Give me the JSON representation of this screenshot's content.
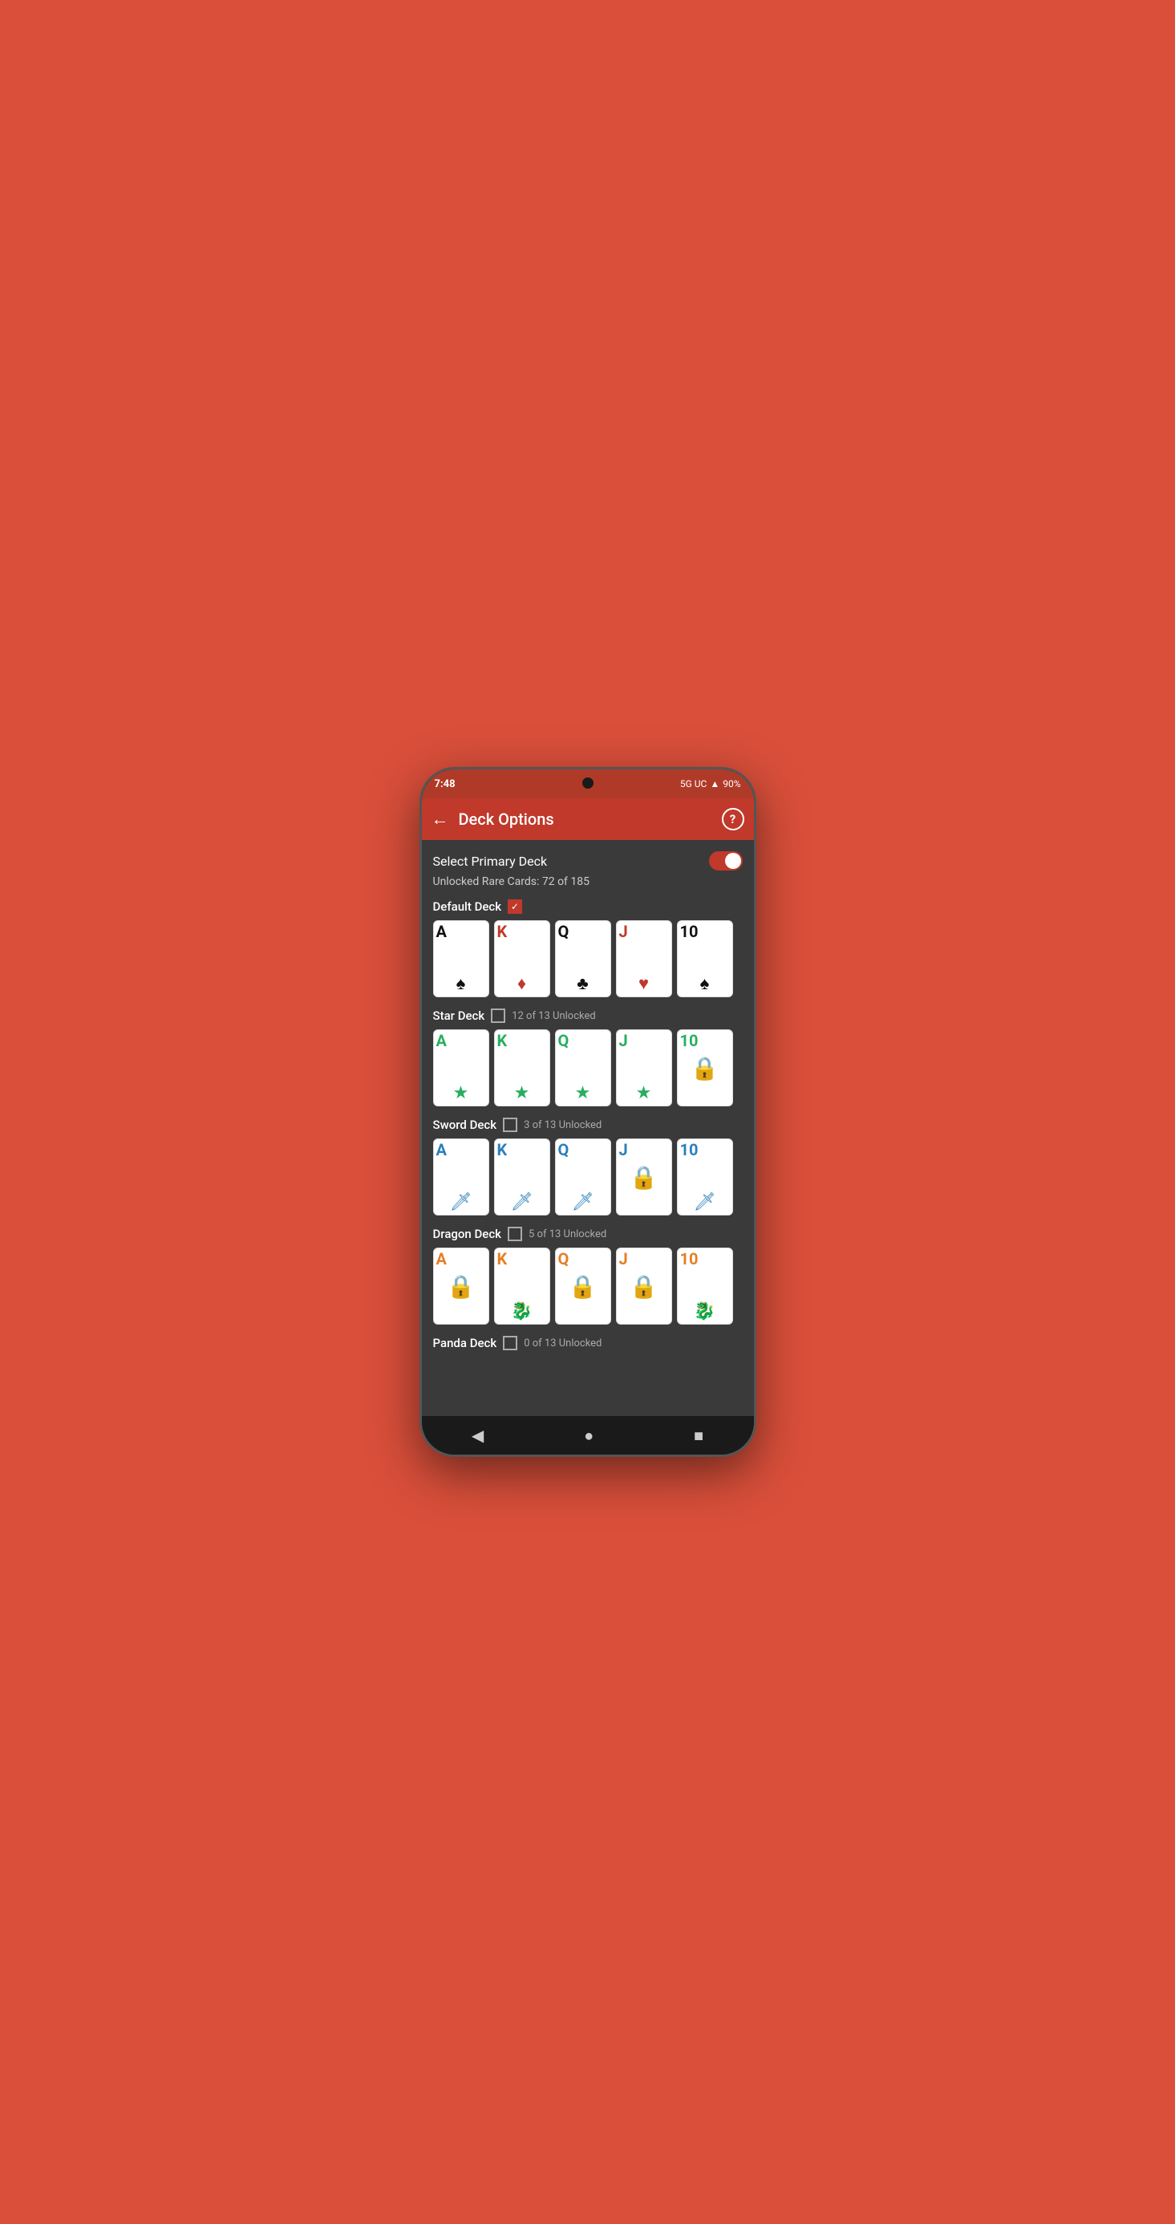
{
  "statusBar": {
    "time": "7:48",
    "network": "5G UC",
    "battery": "90%"
  },
  "appBar": {
    "title": "Deck Options",
    "backLabel": "←",
    "helpLabel": "?"
  },
  "content": {
    "selectPrimaryDeck": "Select Primary Deck",
    "toggleOn": true,
    "unlockedRare": "Unlocked Rare Cards: 72 of 185",
    "decks": [
      {
        "name": "Default Deck",
        "checked": true,
        "unlockText": "",
        "cards": [
          {
            "rank": "A",
            "suit": "♠",
            "color": "black",
            "locked": false
          },
          {
            "rank": "K",
            "suit": "♦",
            "color": "red",
            "locked": false
          },
          {
            "rank": "Q",
            "suit": "♣",
            "color": "black",
            "locked": false
          },
          {
            "rank": "J",
            "suit": "♥",
            "color": "red",
            "locked": false
          },
          {
            "rank": "10",
            "suit": "♠",
            "color": "black",
            "locked": false
          }
        ]
      },
      {
        "name": "Star Deck",
        "checked": false,
        "unlockText": "12 of 13 Unlocked",
        "cards": [
          {
            "rank": "A",
            "suit": "★",
            "color": "green",
            "locked": false
          },
          {
            "rank": "K",
            "suit": "★",
            "color": "green",
            "locked": false
          },
          {
            "rank": "Q",
            "suit": "★",
            "color": "green",
            "locked": false
          },
          {
            "rank": "J",
            "suit": "★",
            "color": "green",
            "locked": false
          },
          {
            "rank": "10",
            "suit": "★",
            "color": "green",
            "locked": true
          }
        ]
      },
      {
        "name": "Sword Deck",
        "checked": false,
        "unlockText": "3 of 13 Unlocked",
        "cards": [
          {
            "rank": "A",
            "suit": "🗡",
            "color": "blue",
            "locked": false
          },
          {
            "rank": "K",
            "suit": "🗡",
            "color": "blue",
            "locked": false
          },
          {
            "rank": "Q",
            "suit": "🗡",
            "color": "blue",
            "locked": false
          },
          {
            "rank": "J",
            "suit": "🗡",
            "color": "blue",
            "locked": true
          },
          {
            "rank": "10",
            "suit": "🗡",
            "color": "blue",
            "locked": false
          }
        ]
      },
      {
        "name": "Dragon Deck",
        "checked": false,
        "unlockText": "5 of 13 Unlocked",
        "cards": [
          {
            "rank": "A",
            "suit": "🐉",
            "color": "orange",
            "locked": true
          },
          {
            "rank": "K",
            "suit": "🐉",
            "color": "orange",
            "locked": false
          },
          {
            "rank": "Q",
            "suit": "🐉",
            "color": "orange",
            "locked": true
          },
          {
            "rank": "J",
            "suit": "🐉",
            "color": "orange",
            "locked": true
          },
          {
            "rank": "10",
            "suit": "🐉",
            "color": "orange",
            "locked": false
          }
        ]
      },
      {
        "name": "Panda Deck",
        "checked": false,
        "unlockText": "0 of 13 Unlocked",
        "cards": []
      }
    ]
  },
  "navBar": {
    "back": "◀",
    "home": "●",
    "recent": "■"
  }
}
